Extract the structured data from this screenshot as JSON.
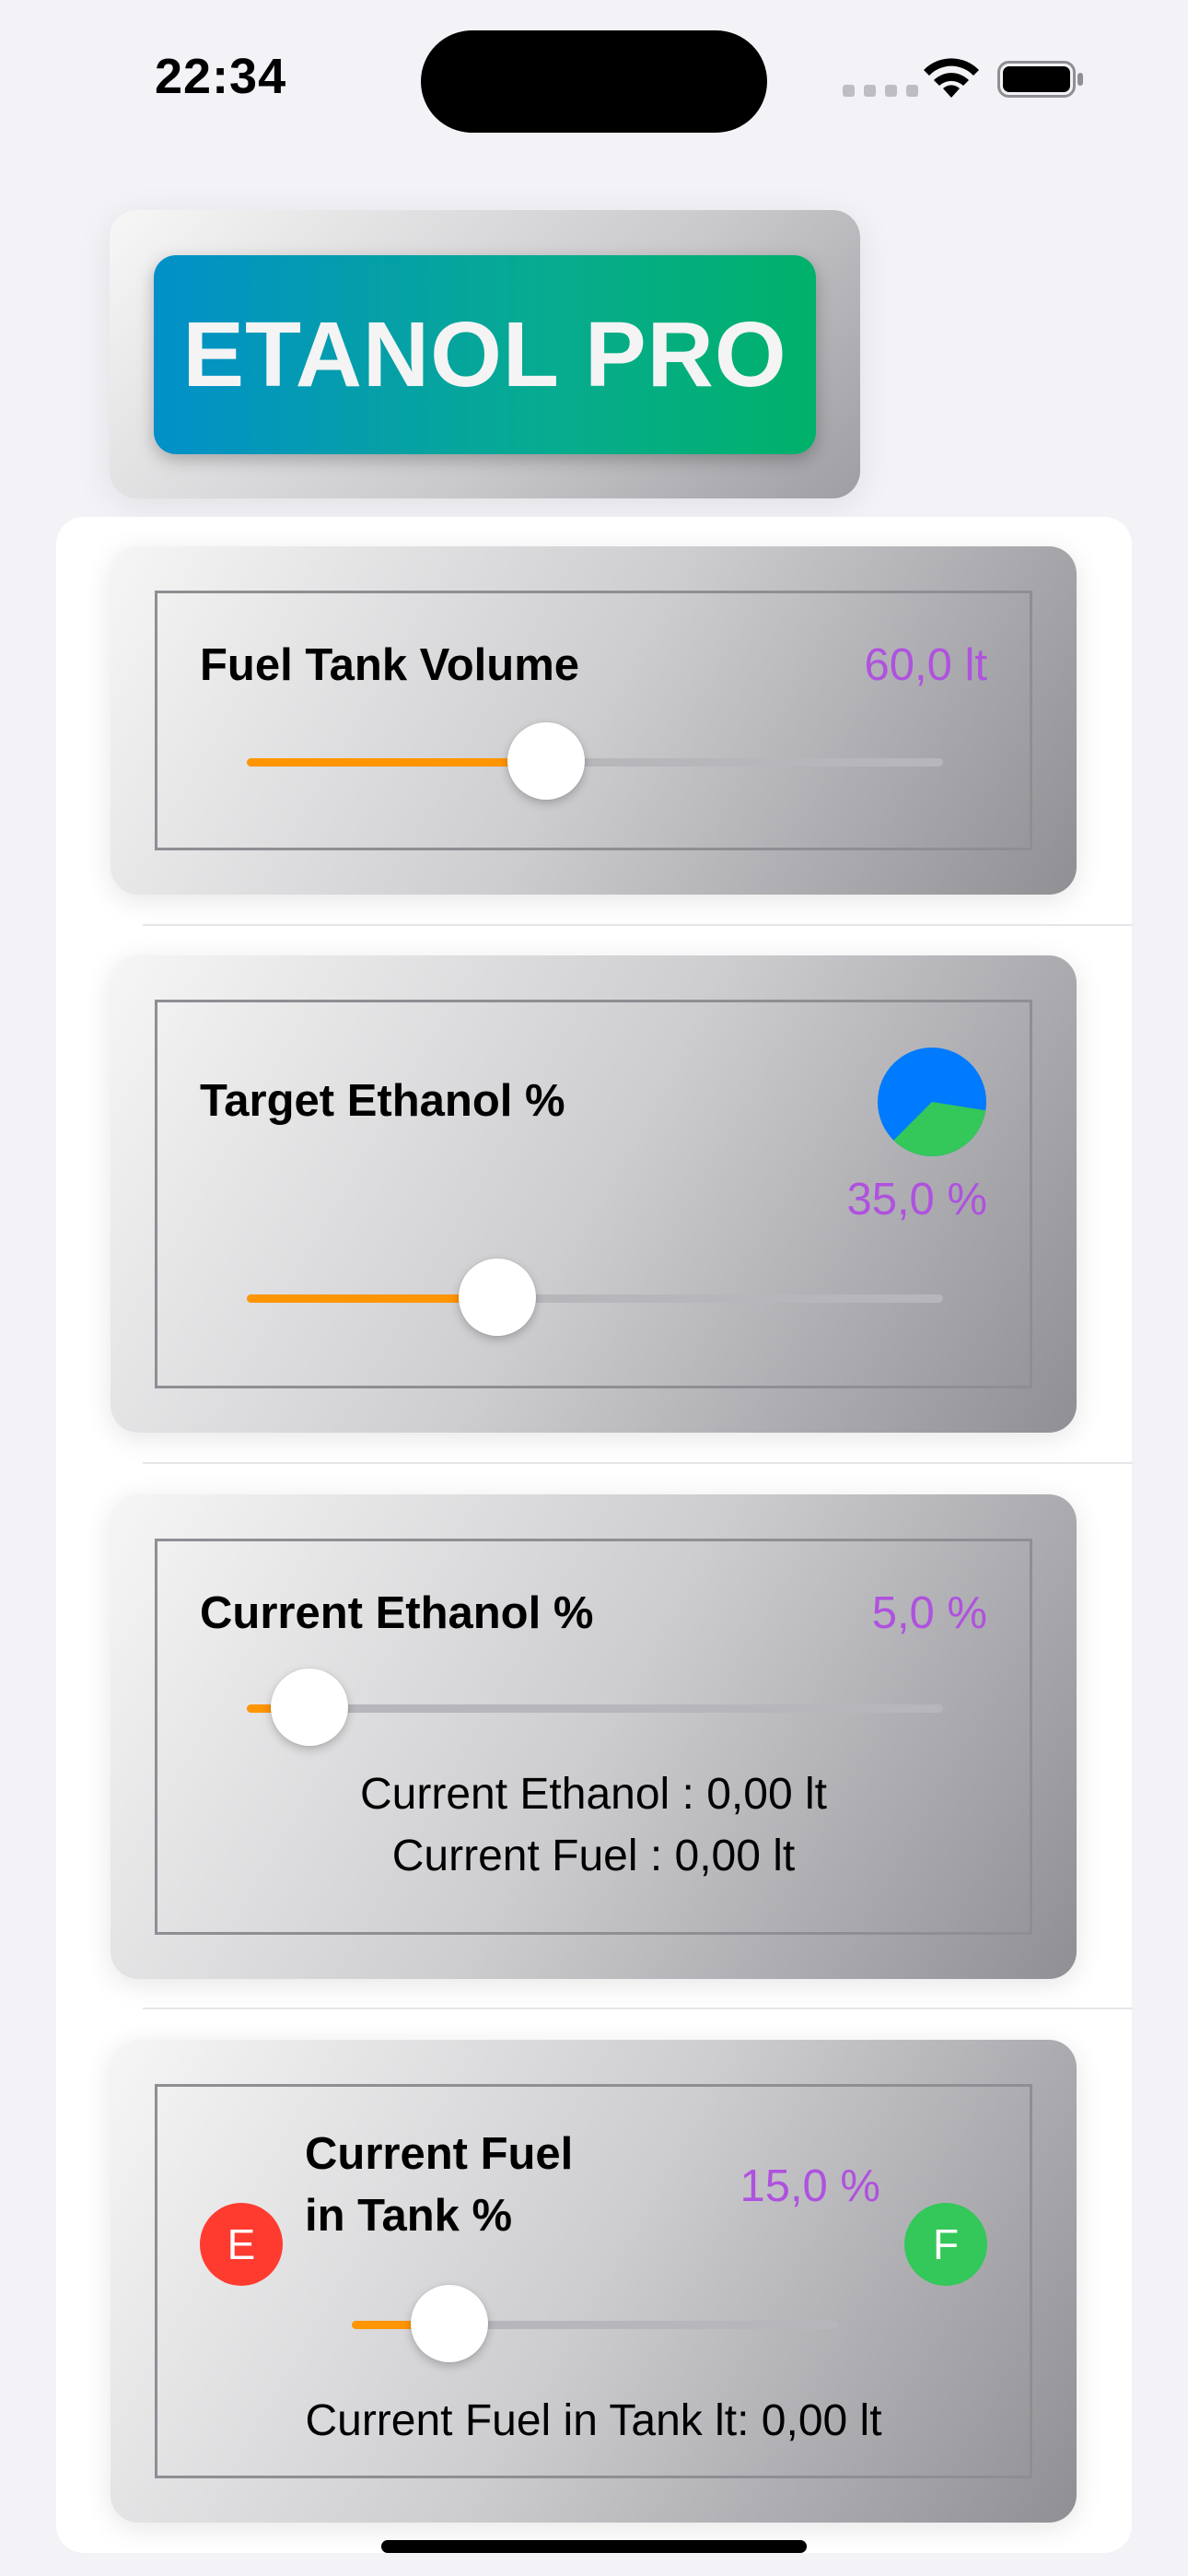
{
  "status_bar": {
    "time": "22:34"
  },
  "app": {
    "title": "ETANOL PRO"
  },
  "cards": {
    "tank_volume": {
      "label": "Fuel Tank Volume",
      "value": "60,0 lt",
      "slider_fraction": 0.43
    },
    "target_ethanol": {
      "label": "Target Ethanol %",
      "value": "35,0 %",
      "slider_fraction": 0.36,
      "pie_green_percent": 35
    },
    "current_ethanol": {
      "label": "Current Ethanol %",
      "value": "5,0 %",
      "slider_fraction": 0.09,
      "ethanol_line": "Current Ethanol :  0,00 lt",
      "fuel_line": "Current Fuel :  0,00 lt"
    },
    "fuel_in_tank": {
      "label_line1": "Current Fuel",
      "label_line2": "in Tank %",
      "value": "15,0 %",
      "slider_fraction": 0.2,
      "empty_badge": "E",
      "full_badge": "F",
      "tank_line": "Current Fuel in Tank lt:  0,00 lt"
    }
  },
  "colors": {
    "accent_value": "#af52de",
    "slider_fill": "#ff9500",
    "pie_blue": "#007aff",
    "pie_green": "#34c759",
    "badge_empty": "#ff3b30",
    "badge_full": "#34c759"
  }
}
